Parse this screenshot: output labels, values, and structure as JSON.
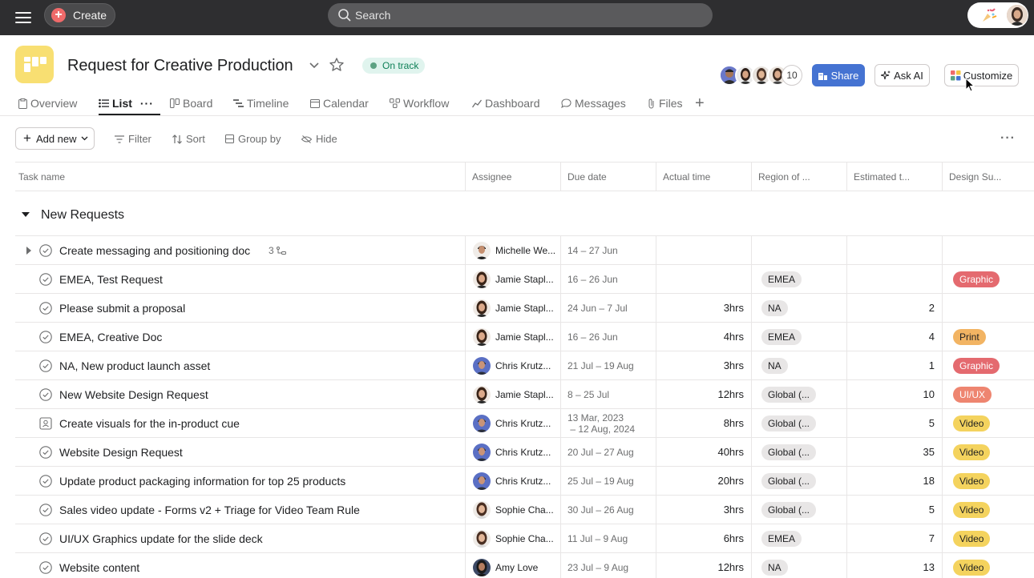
{
  "topbar": {
    "create_label": "Create",
    "search_placeholder": "Search"
  },
  "project": {
    "title": "Request for Creative Production",
    "status": "On track",
    "member_count": "10"
  },
  "actions": {
    "share": "Share",
    "ask_ai": "Ask AI",
    "customize": "Customize"
  },
  "tabs": [
    {
      "label": "Overview",
      "icon": "overview-icon"
    },
    {
      "label": "List",
      "icon": "list-icon",
      "active": true
    },
    {
      "label": "Board",
      "icon": "board-icon"
    },
    {
      "label": "Timeline",
      "icon": "timeline-icon"
    },
    {
      "label": "Calendar",
      "icon": "calendar-icon"
    },
    {
      "label": "Workflow",
      "icon": "workflow-icon"
    },
    {
      "label": "Dashboard",
      "icon": "dashboard-icon"
    },
    {
      "label": "Messages",
      "icon": "messages-icon"
    },
    {
      "label": "Files",
      "icon": "files-icon"
    }
  ],
  "toolbar": {
    "add_new": "Add new",
    "filter": "Filter",
    "sort": "Sort",
    "group_by": "Group by",
    "hide": "Hide"
  },
  "columns": [
    "Task name",
    "Assignee",
    "Due date",
    "Actual time",
    "Region of ...",
    "Estimated t...",
    "Design Su..."
  ],
  "section": {
    "title": "New Requests"
  },
  "rows": [
    {
      "name": "Create messaging and positioning doc",
      "subtasks": "3",
      "assignee": "Michelle We...",
      "due": "14 – 27 Jun",
      "time": "",
      "region": "",
      "est": "",
      "design": ""
    },
    {
      "name": "EMEA, Test Request",
      "assignee": "Jamie Stapl...",
      "due": "16 – 26 Jun",
      "time": "",
      "region": "EMEA",
      "est": "",
      "design": "Graphic"
    },
    {
      "name": "Please submit a proposal",
      "assignee": "Jamie Stapl...",
      "due": "24 Jun – 7 Jul",
      "time": "3hrs",
      "region": "NA",
      "est": "2",
      "design": ""
    },
    {
      "name": "EMEA, Creative Doc",
      "assignee": "Jamie Stapl...",
      "due": "16 – 26 Jun",
      "time": "4hrs",
      "region": "EMEA",
      "est": "4",
      "design": "Print"
    },
    {
      "name": "NA, New product launch asset",
      "assignee": "Chris Krutz...",
      "due": "21 Jul – 19 Aug",
      "time": "3hrs",
      "region": "NA",
      "est": "1",
      "design": "Graphic"
    },
    {
      "name": "New Website Design Request",
      "assignee": "Jamie Stapl...",
      "due": "8 – 25 Jul",
      "time": "12hrs",
      "region": "Global (...",
      "est": "10",
      "design": "UI/UX"
    },
    {
      "name": "Create visuals for the in-product cue",
      "assignee": "Chris Krutz...",
      "due": "13 Mar, 2023\n – 12 Aug, 2024",
      "time": "8hrs",
      "region": "Global (...",
      "est": "5",
      "design": "Video"
    },
    {
      "name": "Website Design Request",
      "assignee": "Chris Krutz...",
      "due": "20 Jul – 27 Aug",
      "time": "40hrs",
      "region": "Global (...",
      "est": "35",
      "design": "Video"
    },
    {
      "name": "Update product packaging information for top 25 products",
      "assignee": "Chris Krutz...",
      "due": "25 Jul – 19 Aug",
      "time": "20hrs",
      "region": "Global (...",
      "est": "18",
      "design": "Video"
    },
    {
      "name": "Sales video update - Forms v2 + Triage for Video Team Rule",
      "assignee": "Sophie Cha...",
      "due": "30 Jul – 26 Aug",
      "time": "3hrs",
      "region": "Global (...",
      "est": "5",
      "design": "Video"
    },
    {
      "name": "UI/UX Graphics update for the slide deck",
      "assignee": "Sophie Cha...",
      "due": "11 Jul – 9 Aug",
      "time": "6hrs",
      "region": "EMEA",
      "est": "7",
      "design": "Video"
    },
    {
      "name": "Website content",
      "assignee": "Amy Love",
      "due": "23 Jul – 9 Aug",
      "time": "12hrs",
      "region": "NA",
      "est": "13",
      "design": "Video"
    }
  ],
  "colors": {
    "accent": "#4573d2",
    "status_green": "#5da283",
    "Graphic": "#e46a6f",
    "Print": "#f2b463",
    "UI/UX": "#ee8570",
    "Video": "#f4d35e"
  }
}
